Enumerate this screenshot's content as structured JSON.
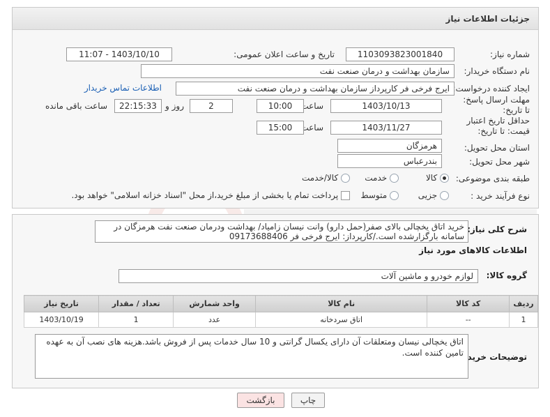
{
  "header": {
    "title": "جزئیات اطلاعات نیاز"
  },
  "fields": {
    "need_number_label": "شماره نیاز:",
    "need_number": "1103093823001840",
    "announce_label": "تاریخ و ساعت اعلان عمومی:",
    "announce_value": "1403/10/10 - 11:07",
    "buyer_org_label": "نام دستگاه خریدار:",
    "buyer_org": "سازمان بهداشت و درمان صنعت نفت",
    "requester_label": "ایجاد کننده درخواست:",
    "requester": "ایرج فرخی فر کارپرداز  سازمان بهداشت و درمان صنعت نفت",
    "contact_link": "اطلاعات تماس خریدار",
    "reply_deadline_label": "مهلت ارسال پاسخ: تا تاریخ:",
    "reply_date": "1403/10/13",
    "time_label": "ساعت",
    "reply_time": "10:00",
    "days_value": "2",
    "days_label": "روز و",
    "remaining_time": "22:15:33",
    "remaining_label": "ساعت باقی مانده",
    "price_validity_label": "حداقل تاریخ اعتبار قیمت: تا تاریخ:",
    "price_date": "1403/11/27",
    "price_time": "15:00",
    "province_label": "استان محل تحویل:",
    "province": "هرمزگان",
    "city_label": "شهر محل تحویل:",
    "city": "بندرعباس",
    "category_label": "طبقه بندی موضوعی:",
    "category_options": [
      "کالا",
      "خدمت",
      "کالا/خدمت"
    ],
    "category_selected": "کالا",
    "purchase_type_label": "نوع فرآیند خرید :",
    "purchase_options": [
      "جزیی",
      "متوسط"
    ],
    "purchase_note": "پرداخت تمام یا بخشی از مبلغ خرید،از محل \"اسناد خزانه اسلامی\" خواهد بود."
  },
  "description": {
    "label": "شرح کلی نیاز:",
    "text": "خرید اتاق یخچالی بالای صفر(حمل دارو) وانت نیسان زامیاد/ بهداشت ودرمان صنعت نفت هرمزگان در سامانه بارگزارشده است./کارپرداز: ایرج فرخی فر 09173688406"
  },
  "goods": {
    "section_title": "اطلاعات کالاهای مورد نیاز",
    "group_label": "گروه کالا:",
    "group_value": "لوازم خودرو و ماشین آلات",
    "columns": [
      "ردیف",
      "کد کالا",
      "نام کالا",
      "واحد شمارش",
      "تعداد / مقدار",
      "تاریخ نیاز"
    ],
    "rows": [
      [
        "1",
        "--",
        "اتاق سردخانه",
        "عدد",
        "1",
        "1403/10/19"
      ]
    ]
  },
  "buyer_notes": {
    "label": "توضیحات خریدار:",
    "text": "اتاق یخچالی نیسان ومتعلقات آن دارای یکسال گرانتی و 10 سال خدمات پس از فروش باشد.هزینه های نصب آن به عهده تامین کننده است."
  },
  "buttons": {
    "print": "چاپ",
    "back": "بازگشت"
  },
  "colors": {
    "link": "#1a5fb4",
    "back_button_bg": "#fbe3e3"
  }
}
